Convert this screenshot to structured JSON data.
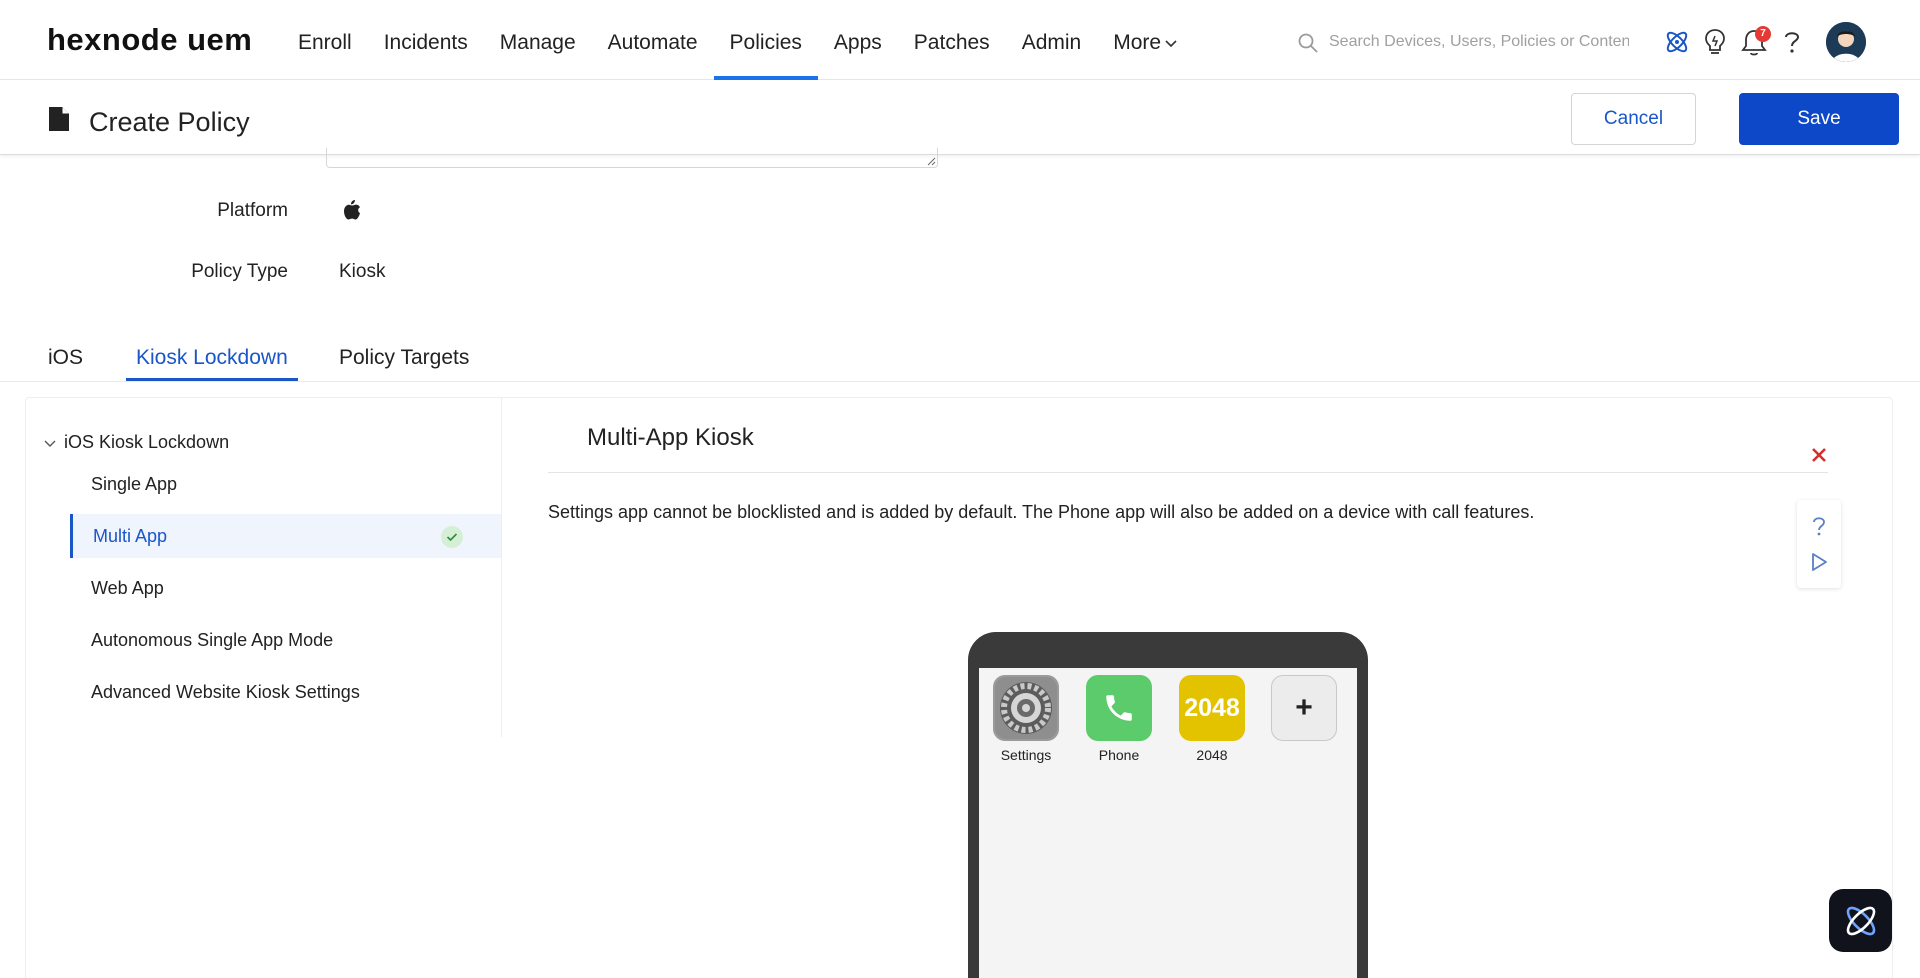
{
  "header": {
    "logo": "hexnode uem",
    "nav": [
      {
        "label": "Enroll"
      },
      {
        "label": "Incidents"
      },
      {
        "label": "Manage"
      },
      {
        "label": "Automate"
      },
      {
        "label": "Policies",
        "active": true
      },
      {
        "label": "Apps"
      },
      {
        "label": "Patches"
      },
      {
        "label": "Admin"
      },
      {
        "label": "More"
      }
    ],
    "search_placeholder": "Search Devices, Users, Policies or Content",
    "notification_count": "7",
    "icons": [
      "atom-icon",
      "lightbulb-icon",
      "bell-icon",
      "help-icon",
      "avatar"
    ]
  },
  "subheader": {
    "title": "Create Policy",
    "cancel_label": "Cancel",
    "save_label": "Save"
  },
  "form": {
    "platform_label": "Platform",
    "platform_value_icon": "apple-icon",
    "policy_type_label": "Policy Type",
    "policy_type_value": "Kiosk"
  },
  "tabs": [
    {
      "label": "iOS"
    },
    {
      "label": "Kiosk Lockdown",
      "active": true
    },
    {
      "label": "Policy Targets"
    }
  ],
  "sidebar": {
    "header": "iOS Kiosk Lockdown",
    "items": [
      {
        "label": "Single App"
      },
      {
        "label": "Multi App",
        "active": true,
        "configured": true
      },
      {
        "label": "Web App"
      },
      {
        "label": "Autonomous Single App Mode"
      },
      {
        "label": "Advanced Website Kiosk Settings"
      }
    ]
  },
  "main": {
    "title": "Multi-App Kiosk",
    "info": "Settings app cannot be blocklisted and is added by default. The Phone app will also be added on a device with call features.",
    "apps": [
      {
        "name": "Settings",
        "icon": "settings-gear-icon"
      },
      {
        "name": "Phone",
        "icon": "phone-icon"
      },
      {
        "name": "2048",
        "icon_text": "2048"
      }
    ],
    "add_symbol": "+"
  },
  "colors": {
    "accent": "#1a56c8",
    "save_button": "#0c48c7",
    "nav_underline": "#1a73e8",
    "phone_app": "#5ccb6b",
    "app_2048": "#e3c200",
    "close_red": "#d32f2f"
  }
}
